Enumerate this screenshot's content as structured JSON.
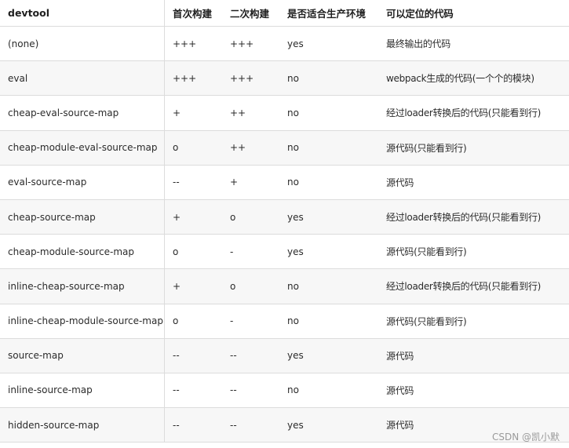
{
  "table": {
    "headers": [
      "devtool",
      "首次构建",
      "二次构建",
      "是否适合生产环境",
      "可以定位的代码"
    ],
    "rows": [
      [
        "(none)",
        "+++",
        "+++",
        "yes",
        "最终输出的代码"
      ],
      [
        "eval",
        "+++",
        "+++",
        "no",
        "webpack生成的代码(一个个的模块)"
      ],
      [
        "cheap-eval-source-map",
        "+",
        "++",
        "no",
        "经过loader转换后的代码(只能看到行)"
      ],
      [
        "cheap-module-eval-source-map",
        "o",
        "++",
        "no",
        "源代码(只能看到行)"
      ],
      [
        "eval-source-map",
        "--",
        "+",
        "no",
        "源代码"
      ],
      [
        "cheap-source-map",
        "+",
        "o",
        "yes",
        "经过loader转换后的代码(只能看到行)"
      ],
      [
        "cheap-module-source-map",
        "o",
        "-",
        "yes",
        "源代码(只能看到行)"
      ],
      [
        "inline-cheap-source-map",
        "+",
        "o",
        "no",
        "经过loader转换后的代码(只能看到行)"
      ],
      [
        "inline-cheap-module-source-map",
        "o",
        "-",
        "no",
        "源代码(只能看到行)"
      ],
      [
        "source-map",
        "--",
        "--",
        "yes",
        "源代码"
      ],
      [
        "inline-source-map",
        "--",
        "--",
        "no",
        "源代码"
      ],
      [
        "hidden-source-map",
        "--",
        "--",
        "yes",
        "源代码"
      ]
    ]
  },
  "watermark": "CSDN @凯小默"
}
